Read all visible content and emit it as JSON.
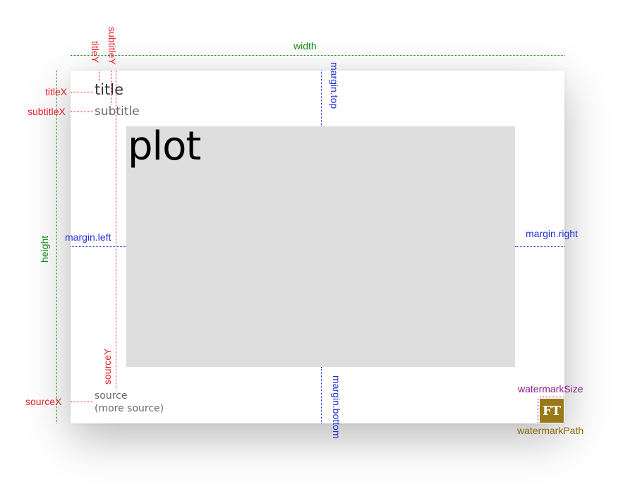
{
  "diagram": {
    "title": "title",
    "subtitle": "subtitle",
    "plot": "plot",
    "source_line1": "source",
    "source_line2": "(more source)",
    "watermark_text": "FT",
    "labels": {
      "width": "width",
      "height": "height",
      "titleY": "titleY",
      "subtitleY": "subtitleY",
      "titleX": "titleX",
      "subtitleX": "subtitleX",
      "sourceX": "sourceX",
      "sourceY": "sourceY",
      "margin_top": "margin.top",
      "margin_left": "margin.left",
      "margin_right": "margin.right",
      "margin_bottom": "margin.bottom",
      "watermark_size": "watermarkSize",
      "watermark_path": "watermarkPath"
    },
    "colors": {
      "red": "#e8202a",
      "blue": "#2230d8",
      "green": "#138a13",
      "purple": "#8a1a8a",
      "olive": "#8a6a0a",
      "plot_fill": "#dedede",
      "watermark_fill": "#9a7a18"
    }
  }
}
